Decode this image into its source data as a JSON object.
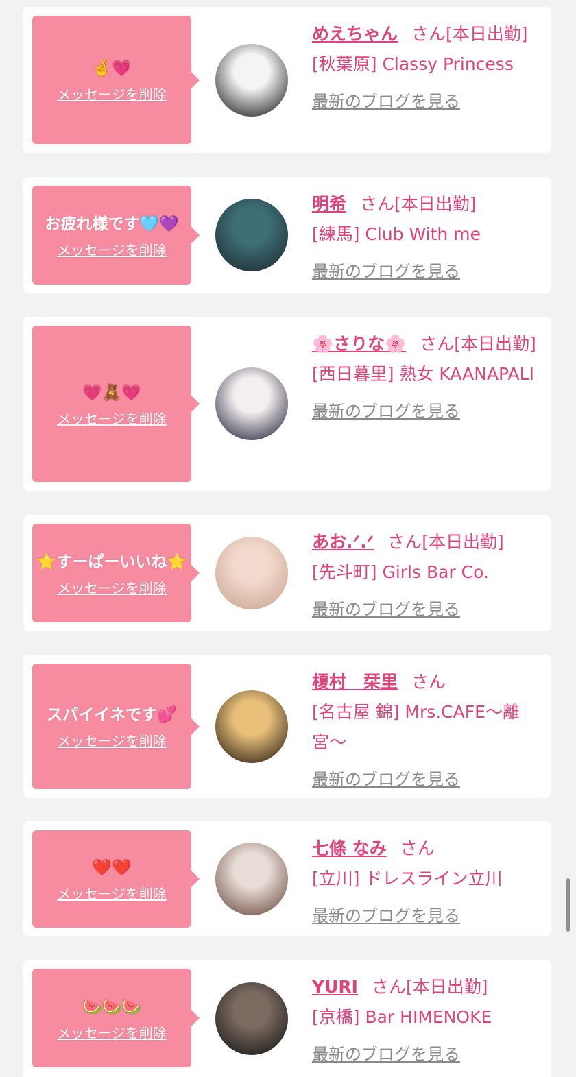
{
  "cards": [
    {
      "message": "🤞💗",
      "delete_label": "メッセージを削除",
      "name": "めえちゃん",
      "suffix": "さん[本日出勤]",
      "store": "[秋葉原] Classy Princess",
      "blog_label": "最新のブログを見る",
      "avatar_colors": [
        "#f4f4f4",
        "#1b1b1b"
      ]
    },
    {
      "message": "お疲れ様です🩵💜",
      "delete_label": "メッセージを削除",
      "name": "明希",
      "suffix": "さん[本日出勤]",
      "store": "[練馬] Club With me",
      "blog_label": "最新のブログを見る",
      "avatar_colors": [
        "#3e6f77",
        "#1d2a2f"
      ]
    },
    {
      "message": "💗🧸💗",
      "delete_label": "メッセージを削除",
      "name": "🌸さりな🌸",
      "suffix": "さん[本日出勤]",
      "store": "[西日暮里] 熟女 KAANAPALI",
      "blog_label": "最新のブログを見る",
      "avatar_colors": [
        "#f5eef0",
        "#22253a"
      ]
    },
    {
      "message": "⭐すーぱーいいね⭐",
      "delete_label": "メッセージを削除",
      "name": "あお.ᐟ.ᐟ",
      "suffix": "さん[本日出勤]",
      "store": "[先斗町] Girls Bar Co.",
      "blog_label": "最新のブログを見る",
      "avatar_colors": [
        "#f2d9cd",
        "#c9a48f"
      ]
    },
    {
      "message": "スパイイネです💕",
      "delete_label": "メッセージを削除",
      "name": "榎村　栞里",
      "suffix": "さん",
      "store": "[名古屋 錦] Mrs.CAFE〜離宮〜",
      "blog_label": "最新のブログを見る",
      "avatar_colors": [
        "#e9c07a",
        "#2a1d14"
      ]
    },
    {
      "message": "❤️❤️",
      "delete_label": "メッセージを削除",
      "name": "七條 なみ",
      "suffix": "さん",
      "store": "[立川] ドレスライン立川",
      "blog_label": "最新のブログを見る",
      "avatar_colors": [
        "#e8dcd6",
        "#6a4a3e"
      ]
    },
    {
      "message": "🍉🍉🍉",
      "delete_label": "メッセージを削除",
      "name": "YURI",
      "suffix": "さん[本日出勤]",
      "store": "[京橋] Bar HIMENOKE",
      "blog_label": "最新のブログを見る",
      "avatar_colors": [
        "#7b6a60",
        "#151515"
      ]
    }
  ]
}
